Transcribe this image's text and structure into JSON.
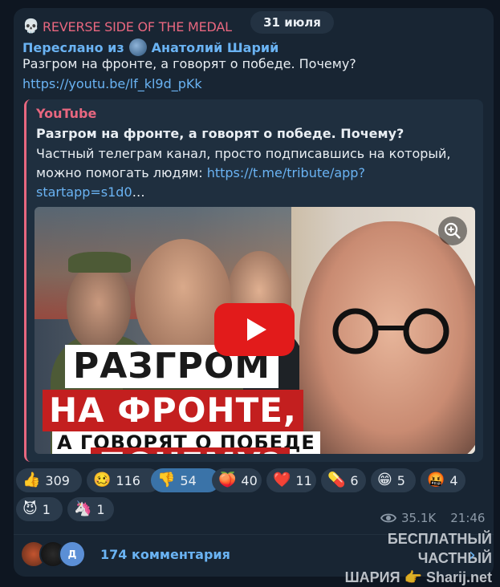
{
  "post": {
    "channel_name": "REVERSE SIDE OF THE MEDAL",
    "date": "31 июля",
    "forwarded_prefix": "Переслано из",
    "forwarded_from": "Анатолий Шарий",
    "text": "Разгром на фронте, а говорят о победе. Почему?",
    "link": "https://youtu.be/lf_kl9d_pKk"
  },
  "preview": {
    "source": "YouTube",
    "title": "Разгром на фронте, а говорят о победе. Почему?",
    "desc_line1": "Частный телеграм канал, просто подписавшись на который,",
    "desc_line2_text": "можно помогать людям: ",
    "desc_line2_link": "https://t.me/tribute/app?",
    "desc_line3_link": "startapp=s1d0",
    "desc_line3_ellipsis": "…",
    "thumbnail_caption": {
      "line1": "РАЗГРОМ",
      "line2": "НА ФРОНТЕ,",
      "line3": "А ГОВОРЯТ О ПОБЕДЕ",
      "line4": "ПОЧЕМУ?"
    }
  },
  "reactions": [
    {
      "emoji": "👍",
      "count": "309",
      "selected": false
    },
    {
      "emoji": "🥴",
      "count": "116",
      "selected": false
    },
    {
      "emoji": "👎",
      "count": "54",
      "selected": true
    },
    {
      "emoji": "🍑",
      "count": "40",
      "selected": false
    },
    {
      "emoji": "❤️",
      "count": "11",
      "selected": false
    },
    {
      "emoji": "💊",
      "count": "6",
      "selected": false
    },
    {
      "emoji": "😁",
      "count": "5",
      "selected": false
    },
    {
      "emoji": "🤬",
      "count": "4",
      "selected": false
    },
    {
      "emoji": "😈",
      "count": "1",
      "selected": false
    },
    {
      "emoji": "🦄",
      "count": "1",
      "selected": false
    }
  ],
  "meta": {
    "views": "35.1K",
    "time": "21:46"
  },
  "comments": {
    "label": "174 комментария",
    "avatar_letter": "Д"
  },
  "watermark": {
    "line1": "БЕСПЛАТНЫЙ ЧАСТНЫЙ",
    "line2": "ШАРИЯ 👉 Sharij.net"
  },
  "colors": {
    "background": "#0e1621",
    "bubble": "#182533",
    "link": "#6ab3f3",
    "channel_accent": "#e8677f",
    "reaction_pill": "#2b3b4c",
    "reaction_selected": "#3a73a8"
  }
}
